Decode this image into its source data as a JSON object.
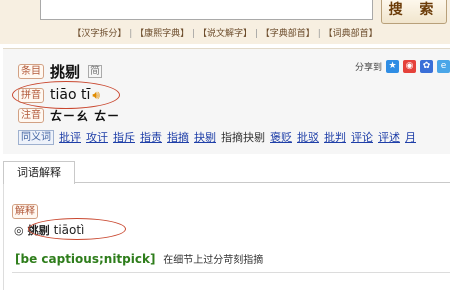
{
  "search": {
    "button_label": "搜 索",
    "links": [
      "【汉字拆分】",
      "【康熙字典】",
      "【说文解字】",
      "【字典部首】",
      "【词典部首】"
    ]
  },
  "entry": {
    "tag_entry": "条目",
    "word": "挑剔",
    "mini_icon": "简",
    "tag_pinyin": "拼音",
    "pinyin": "tiāo tī",
    "speaker_icon": "speaker-icon",
    "tag_zhuyin": "注音",
    "zhuyin": "ㄊㄧㄠ ㄊㄧ",
    "tag_synonyms": "同义词",
    "synonyms": [
      "批评",
      "攻讦",
      "指斥",
      "指责",
      "指摘",
      "抉剔",
      "指摘抉剔",
      "褒贬",
      "批驳",
      "批判",
      "评论",
      "评述",
      "月"
    ],
    "share_label": "分享到"
  },
  "tabs": {
    "active": "词语解释"
  },
  "definition": {
    "tag": "解释",
    "bullet": "◎",
    "word": "挑剔",
    "pinyin": "tiāotì",
    "english": "[be captious;nitpick]",
    "chinese": "在细节上过分苛刻指摘"
  }
}
